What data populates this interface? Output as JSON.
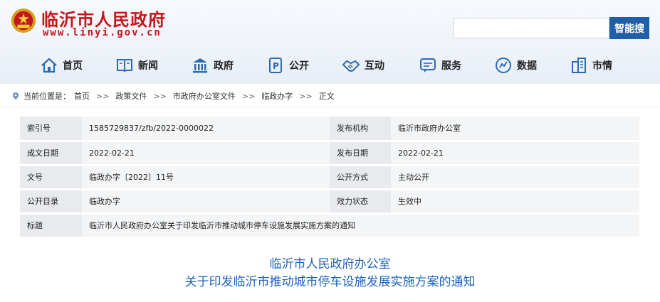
{
  "header": {
    "site_title": "临沂市人民政府",
    "site_domain": "www.linyi.gov.cn",
    "search_placeholder": "",
    "search_button": "智能搜"
  },
  "nav": {
    "items": [
      {
        "label": "首页",
        "icon": "home-icon"
      },
      {
        "label": "新闻",
        "icon": "book-icon"
      },
      {
        "label": "政府",
        "icon": "building-icon"
      },
      {
        "label": "公开",
        "icon": "document-icon"
      },
      {
        "label": "互动",
        "icon": "handshake-icon"
      },
      {
        "label": "服务",
        "icon": "chat-icon"
      },
      {
        "label": "数据",
        "icon": "data-icon"
      },
      {
        "label": "市情",
        "icon": "city-icon"
      }
    ]
  },
  "breadcrumb": {
    "prefix": "当前位置是：",
    "items": [
      "首页",
      "政策文件",
      "市政府办公室文件",
      "临政办字",
      "正文"
    ],
    "separator": ">>"
  },
  "meta": {
    "index_label": "索引号",
    "index_value": "1585729837/zfb/2022-0000022",
    "org_label": "发布机构",
    "org_value": "临沂市政府办公室",
    "created_label": "成文日期",
    "created_value": "2022-02-21",
    "published_label": "发布日期",
    "published_value": "2022-02-21",
    "docno_label": "文号",
    "docno_value": "临政办字〔2022〕11号",
    "openmode_label": "公开方式",
    "openmode_value": "主动公开",
    "catalog_label": "公开目录",
    "catalog_value": "临政办字",
    "status_label": "效力状态",
    "status_value": "生效中",
    "title_label": "标题",
    "title_value": "临沂市人民政府办公室关于印发临沂市推动城市停车设施发展实施方案的通知"
  },
  "document": {
    "title_line1": "临沂市人民政府办公室",
    "title_line2": "关于印发临沂市推动城市停车设施发展实施方案的通知"
  },
  "colors": {
    "brand_red": "#c4161c",
    "accent_blue": "#1f5fa8",
    "title_blue": "#1e62b8"
  }
}
